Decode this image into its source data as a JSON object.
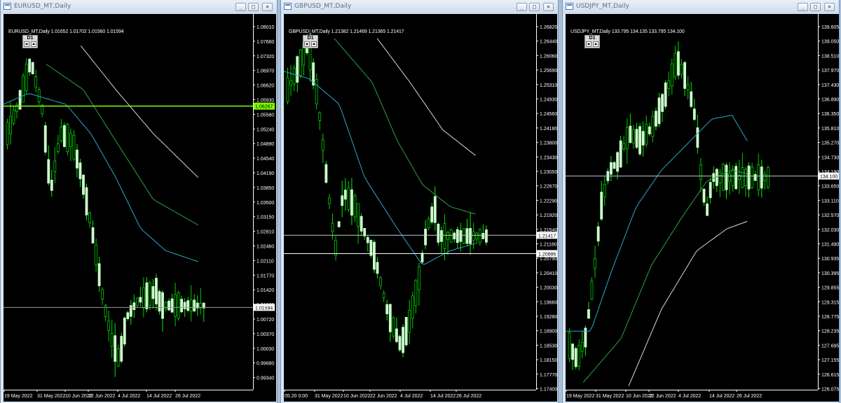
{
  "colors": {
    "bull_body": "#ccffcc",
    "bull_wick": "#00ee00",
    "bear": "#00cc00",
    "axis_text": "#ffffff",
    "tag_bg": "#ffffff",
    "tag_text": "#000000",
    "green_line_tag": "#7fff00"
  },
  "icons": {
    "window": "chart-window-icon",
    "minimize": "minimize-icon",
    "maximize": "maximize-icon",
    "close": "close-icon",
    "tf_down": "period-down-arrow-icon",
    "tf_up": "period-up-arrow-icon"
  },
  "windows": [
    {
      "title": "EURUSD_MT,Daily",
      "symbol_line": "EURUSD_MT,Daily  1.01652 1.01702 1.01560 1.01594",
      "timeframe": "D1",
      "controls": {
        "min": "_",
        "max": "□",
        "close": "×"
      },
      "price_scale": [
        "1.08010",
        "1.07660",
        "1.07320",
        "1.06970",
        "1.06620",
        "1.05930",
        "1.05580",
        "1.05240",
        "1.04890",
        "1.04540",
        "1.04190",
        "1.03850",
        "1.03500",
        "1.03150",
        "1.02810",
        "1.02460",
        "1.02110",
        "1.01770",
        "1.01420",
        "1.01070",
        "1.00720",
        "1.00370",
        "1.00030",
        "0.99680",
        "0.99340"
      ],
      "date_scale": [
        "19 May 2022",
        "31 May 2022",
        "10 Jun 2022",
        "22 Jun 2022",
        "4 Jul 2022",
        "14 Jul 2022",
        "26 Jul 2022"
      ],
      "price_tags": [
        {
          "text": "1.06267",
          "kind": "green"
        },
        {
          "text": "1.01594",
          "kind": "white"
        }
      ]
    },
    {
      "title": "GBPUSD_MT,Daily",
      "symbol_line": "GBPUSD_MT,Daily  1.21382 1.21469 1.21365 1.21417",
      "timeframe": "D1",
      "controls": {
        "min": "_",
        "max": "□",
        "close": "×"
      },
      "price_scale": [
        "1.26820",
        "1.26440",
        "1.26060",
        "1.25690",
        "1.25310",
        "1.24930",
        "1.24560",
        "1.24180",
        "1.23800",
        "1.23430",
        "1.23050",
        "1.22670",
        "1.22290",
        "1.21920",
        "1.21540",
        "1.21160",
        "1.20790",
        "1.20410",
        "1.20030",
        "1.19660",
        "1.19280",
        "1.18900",
        "1.18530",
        "1.18150",
        "1.17770",
        "1.17400"
      ],
      "date_scale": [
        "05.20 0:00",
        "31 May 2022",
        "10 Jun 2022",
        "22 Jun 2022",
        "4 Jul 2022",
        "14 Jul 2022",
        "26 Jul 2022"
      ],
      "price_tags": [
        {
          "text": "1.21417",
          "kind": "white"
        },
        {
          "text": "1.20886",
          "kind": "white"
        }
      ]
    },
    {
      "title": "USDJPY_MT,Daily",
      "symbol_line": "USDJPY_MT,Daily  133.795 134.135 133.795 134.100",
      "timeframe": "D1",
      "controls": {
        "min": "_",
        "max": "□",
        "close": "×"
      },
      "price_scale": [
        "139.605",
        "139.050",
        "138.510",
        "137.970",
        "137.430",
        "136.890",
        "136.350",
        "135.810",
        "135.270",
        "134.730",
        "134.190",
        "133.650",
        "133.110",
        "132.570",
        "132.030",
        "131.490",
        "130.935",
        "130.395",
        "129.855",
        "129.315",
        "128.775",
        "128.235",
        "127.695",
        "127.155",
        "126.615",
        "126.075"
      ],
      "date_scale": [
        "19 May 2022",
        "31 May 2022",
        "10 Jun 2022",
        "22 Jun 2022",
        "4 Jul 2022",
        "14 Jul 2022",
        "26 Jul 2022"
      ],
      "price_tags": [
        {
          "text": "134.100",
          "kind": "white"
        }
      ]
    }
  ]
}
